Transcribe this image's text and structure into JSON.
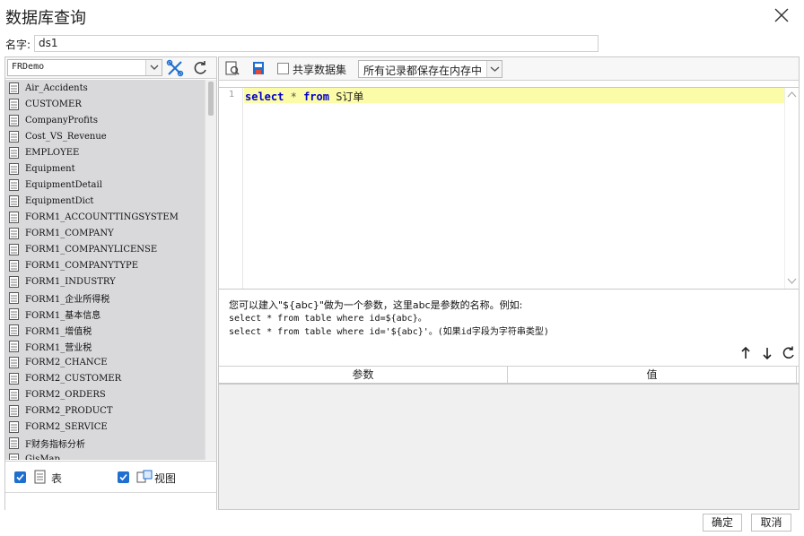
{
  "dialog": {
    "title": "数据库查询",
    "close_icon": "close-icon"
  },
  "name_row": {
    "label": "名字:",
    "value": "ds1"
  },
  "left": {
    "db_selected": "FRDemo",
    "tables": [
      "Air_Accidents",
      "CUSTOMER",
      "CompanyProfits",
      "Cost_VS_Revenue",
      "EMPLOYEE",
      "Equipment",
      "EquipmentDetail",
      "EquipmentDict",
      "FORM1_ACCOUNTTINGSYSTEM",
      "FORM1_COMPANY",
      "FORM1_COMPANYLICENSE",
      "FORM1_COMPANYTYPE",
      "FORM1_INDUSTRY",
      "FORM1_企业所得税",
      "FORM1_基本信息",
      "FORM1_增值税",
      "FORM1_营业税",
      "FORM2_CHANCE",
      "FORM2_CUSTOMER",
      "FORM2_ORDERS",
      "FORM2_PRODUCT",
      "FORM2_SERVICE",
      "F财务指标分析",
      "GisMap"
    ],
    "show_tables_label": "表",
    "show_views_label": "视图",
    "accent_color": "#1e6fd0"
  },
  "right": {
    "share_label": "共享数据集",
    "mode_selected": "所有记录都保存在内存中",
    "line_number": "1",
    "sql": {
      "select": "select",
      "star": "*",
      "from": "from",
      "table": "S订单"
    },
    "hint": {
      "line1": "您可以建入\"${abc}\"做为一个参数，这里abc是参数的名称。例如:",
      "line2": "select * from table where id=${abc}。",
      "line3": "select * from table where id='${abc}'。(如果id字段为字符串类型)"
    },
    "param_header": {
      "param": "参数",
      "value": "值"
    },
    "editor_highlight_color": "#fbfba8"
  },
  "footer": {
    "ok_label": "确定",
    "cancel_label": "取消"
  }
}
